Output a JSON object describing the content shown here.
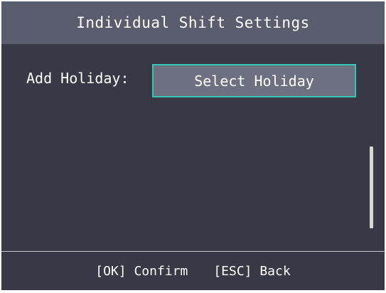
{
  "header": {
    "title": "Individual Shift Settings"
  },
  "form": {
    "add_holiday_label": "Add Holiday:",
    "select_holiday_value": "Select Holiday"
  },
  "footer": {
    "ok_hint": "[OK] Confirm",
    "esc_hint": "[ESC] Back"
  },
  "colors": {
    "background": "#373947",
    "title_bar": "#5a5d6e",
    "selected_field": "#6d7080",
    "focus_border": "#34c6b6"
  },
  "icons": {
    "scrollbar": "vertical-scrollbar"
  }
}
